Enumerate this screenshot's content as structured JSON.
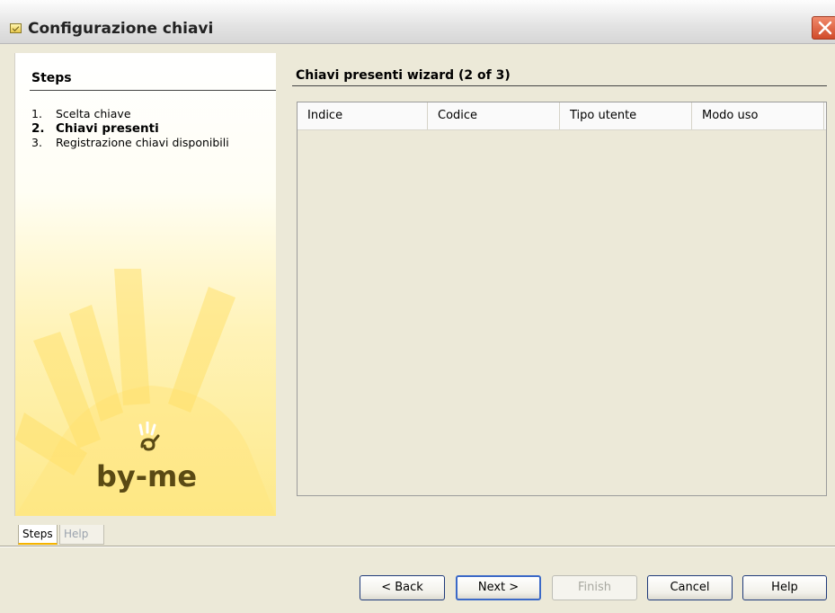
{
  "window": {
    "title": "Configurazione chiavi"
  },
  "steps_panel": {
    "heading": "Steps",
    "items": [
      {
        "num": "1.",
        "label": "Scelta chiave",
        "current": false
      },
      {
        "num": "2.",
        "label": "Chiavi presenti",
        "current": true
      },
      {
        "num": "3.",
        "label": "Registrazione chiavi disponibili",
        "current": false
      }
    ],
    "logo_text": "by-me",
    "tabs": [
      "Steps",
      "Help"
    ]
  },
  "content": {
    "heading": "Chiavi presenti wizard (2 of 3)",
    "table": {
      "columns": [
        "Indice",
        "Codice",
        "Tipo utente",
        "Modo uso"
      ],
      "rows": []
    }
  },
  "buttons": {
    "back": "< Back",
    "next": "Next >",
    "finish": "Finish",
    "cancel": "Cancel",
    "help": "Help"
  },
  "colors": {
    "accent_yellow": "#fde98a",
    "default_button_border": "#3b69c7",
    "close_button": "#d14b2a"
  }
}
